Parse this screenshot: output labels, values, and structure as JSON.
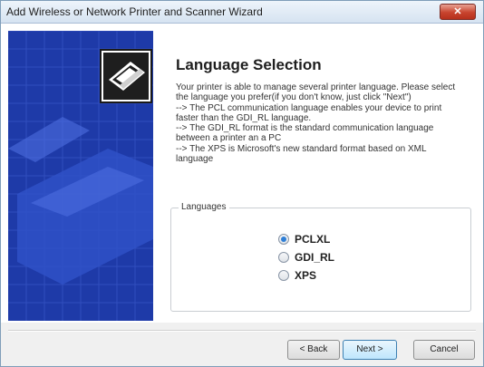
{
  "window": {
    "title": "Add Wireless or Network Printer and Scanner Wizard",
    "close_label": "✕"
  },
  "page": {
    "heading": "Language Selection",
    "description_lines": [
      "Your printer is able to manage several printer language. Please select",
      "the language you prefer(if you don't know, just click \"Next\")",
      "--> The PCL communication language enables your device to print",
      "faster than the GDI_RL language.",
      "--> The GDI_RL format is the standard communication language",
      "between a printer an a PC",
      "--> The XPS  is Microsoft's new standard format based on XML",
      "language"
    ]
  },
  "languages": {
    "group_label": "Languages",
    "options": [
      {
        "label": "PCLXL",
        "selected": true
      },
      {
        "label": "GDI_RL",
        "selected": false
      },
      {
        "label": "XPS",
        "selected": false
      }
    ]
  },
  "buttons": {
    "back": "< Back",
    "next": "Next >",
    "cancel": "Cancel"
  },
  "icons": {
    "side_icon": "printer-icon",
    "close": "close-icon"
  },
  "colors": {
    "side_panel": "#1e3aa8",
    "radio_selected": "#2f7fd6"
  }
}
